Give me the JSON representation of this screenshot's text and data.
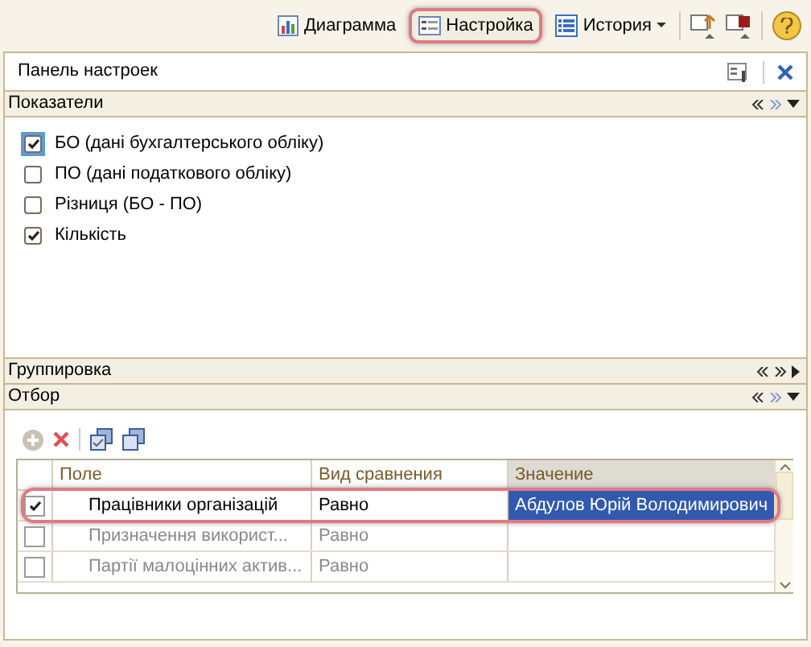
{
  "toolbar": {
    "buttons": [
      {
        "label": "Диаграмма",
        "kind": "chart",
        "highlighted": false,
        "dropdown": false
      },
      {
        "label": "Настройка",
        "kind": "settings",
        "highlighted": true,
        "dropdown": false
      },
      {
        "label": "История",
        "kind": "list",
        "highlighted": false,
        "dropdown": true
      }
    ]
  },
  "panel": {
    "title": "Панель настроек"
  },
  "sections": [
    {
      "title": "Показатели",
      "expanded": true,
      "items": [
        {
          "label": "БО (дані бухгалтерського обліку)",
          "checked": true,
          "selected": true
        },
        {
          "label": "ПО (дані податкового обліку)",
          "checked": false,
          "selected": false
        },
        {
          "label": "Різниця (БО - ПО)",
          "checked": false,
          "selected": false
        },
        {
          "label": "Кількість",
          "checked": true,
          "selected": false
        }
      ]
    },
    {
      "title": "Группировка",
      "expanded": false
    },
    {
      "title": "Отбор",
      "expanded": true,
      "table": {
        "columns": [
          "Поле",
          "Вид сравнения",
          "Значение"
        ],
        "rows": [
          {
            "checked": true,
            "selected": true,
            "field": "Працівники організацій",
            "comparison": "Равно",
            "value": "Абдулов Юрій Володимирович"
          },
          {
            "checked": false,
            "selected": false,
            "field": "Призначення використ...",
            "comparison": "Равно"
          },
          {
            "checked": false,
            "selected": false,
            "field": "Партії малоцінних актив...",
            "comparison": "Равно"
          }
        ]
      }
    }
  ]
}
